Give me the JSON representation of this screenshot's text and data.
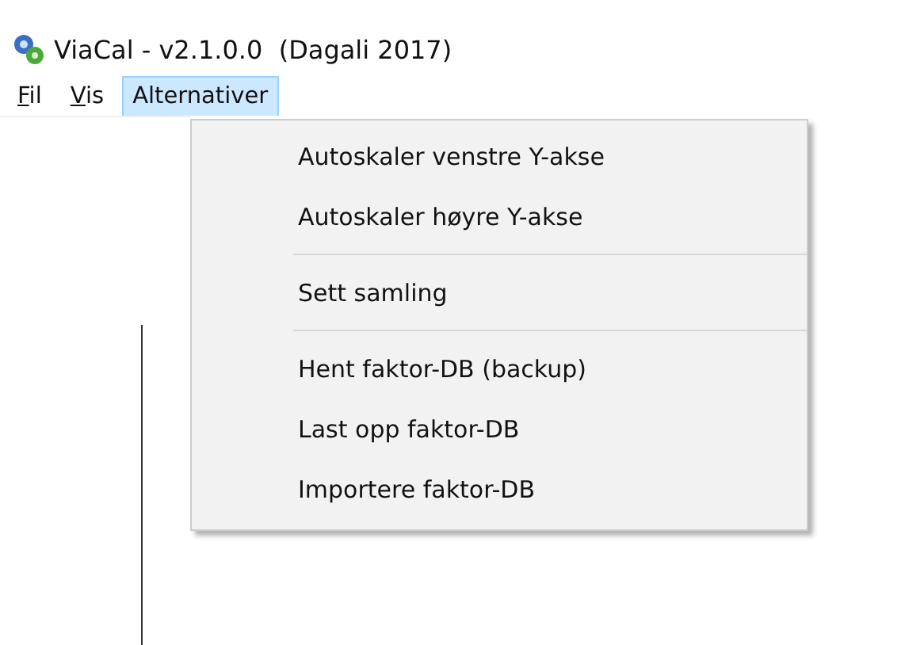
{
  "window": {
    "title": "ViaCal - v2.1.0.0  (Dagali 2017)"
  },
  "menu_bar": [
    {
      "key": "F",
      "rest": "il",
      "selected": false
    },
    {
      "key": "V",
      "rest": "is",
      "selected": false
    },
    {
      "rest": "Alternativer",
      "selected": true
    }
  ],
  "dropdown": [
    {
      "kind": "item",
      "label": "Autoskaler venstre Y-akse"
    },
    {
      "kind": "item",
      "label": "Autoskaler høyre Y-akse"
    },
    {
      "kind": "separator"
    },
    {
      "kind": "item",
      "label": "Sett samling"
    },
    {
      "kind": "separator"
    },
    {
      "kind": "item",
      "label": "Hent faktor-DB (backup)"
    },
    {
      "kind": "item",
      "label": "Last opp faktor-DB"
    },
    {
      "kind": "item",
      "label": "Importere faktor-DB"
    }
  ]
}
